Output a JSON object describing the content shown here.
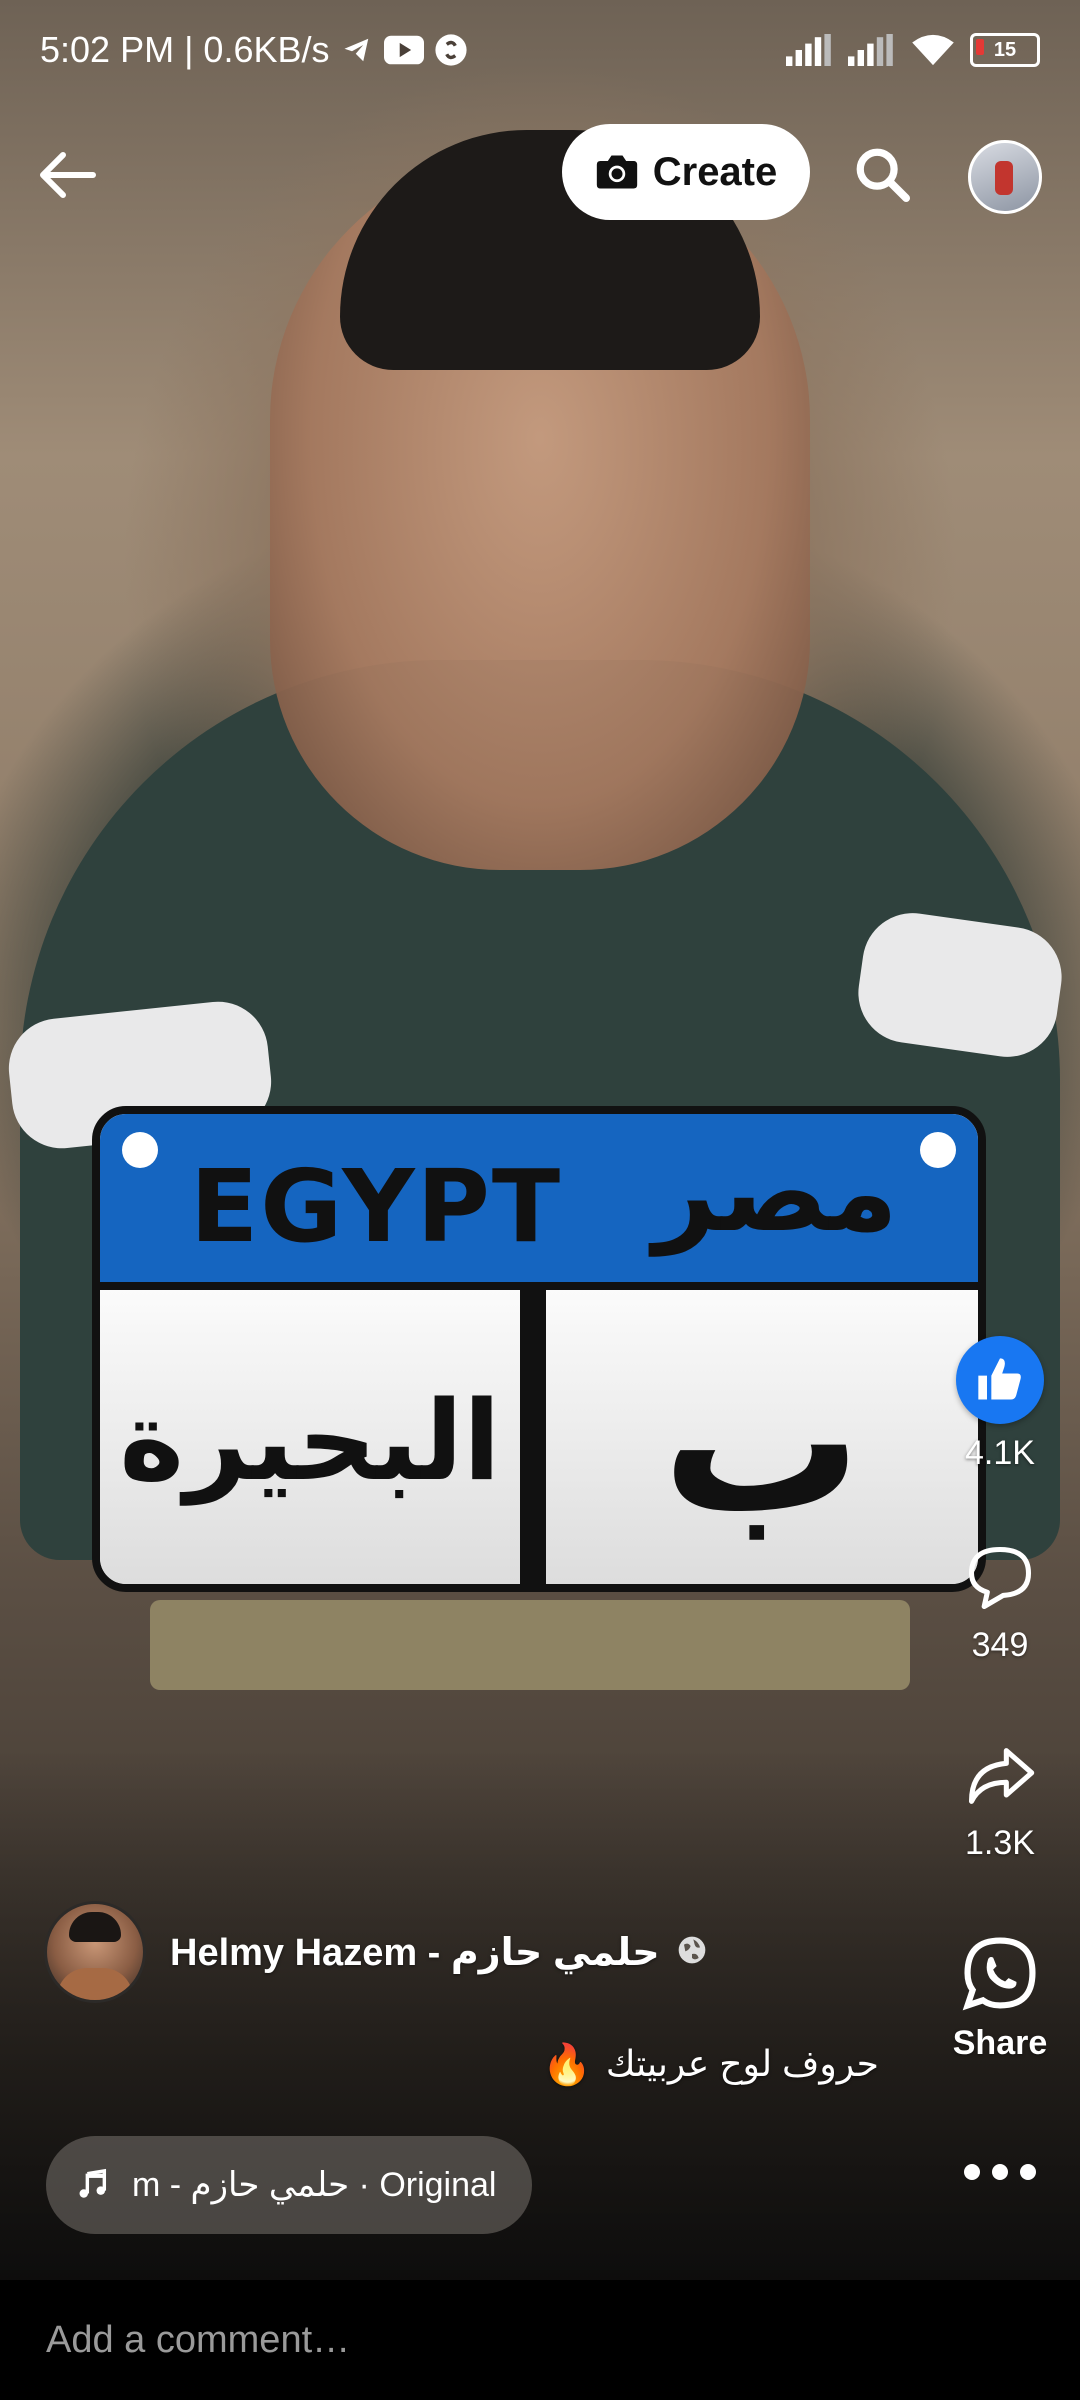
{
  "status_bar": {
    "time_speed": "5:02 PM | 0.6KB/s",
    "battery": "15",
    "icons": [
      "telegram-icon",
      "youtube-icon",
      "shazam-icon",
      "signal-icon",
      "signal-icon",
      "wifi-icon",
      "battery-icon"
    ]
  },
  "top_bar": {
    "back_icon": "arrow-left-icon",
    "create_label": "Create",
    "create_icon": "camera-icon",
    "search_icon": "search-icon"
  },
  "video_overlay": {
    "plate_country_en": "EGYPT",
    "plate_country_ar": "مصر",
    "plate_city": "البحيرة",
    "plate_letter": "ب"
  },
  "actions": {
    "like_count": "4.1K",
    "comment_count": "349",
    "share_count": "1.3K",
    "whatsapp_label": "Share",
    "colors": {
      "like": "#1877f2"
    }
  },
  "post": {
    "author_name": "Helmy Hazem - حلمي حازم",
    "caption": "حروف لوح عربيتك",
    "caption_emoji": "🔥",
    "audio_label": "m - حلمي حازم · Original"
  },
  "comment": {
    "placeholder": "Add a comment…"
  }
}
